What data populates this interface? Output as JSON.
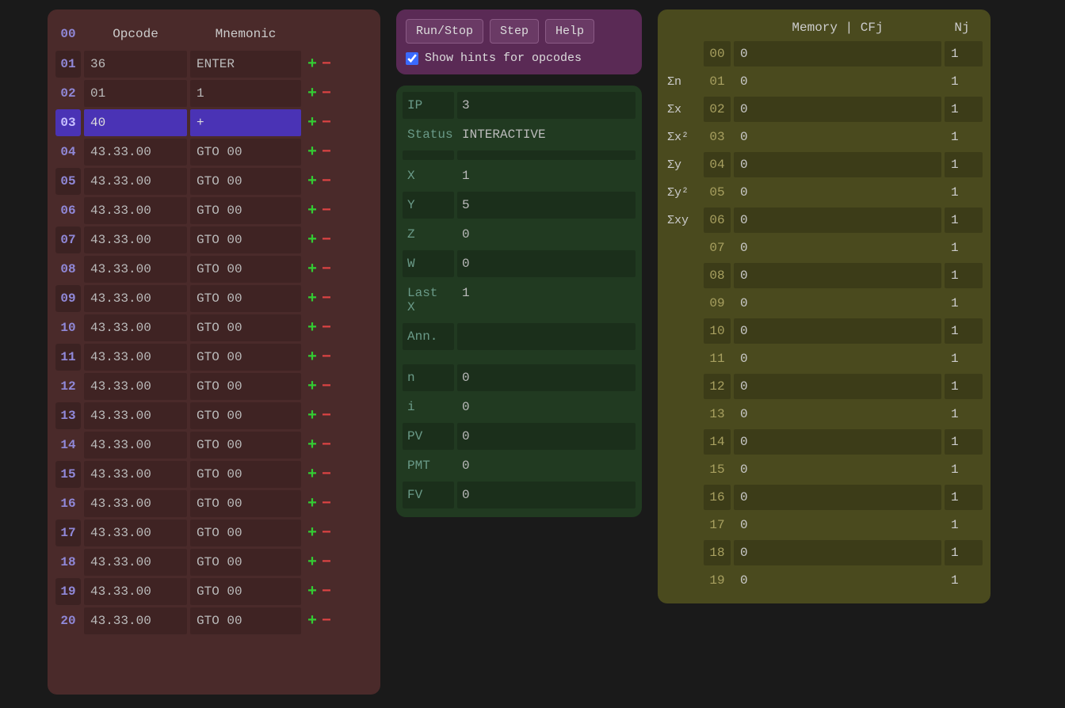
{
  "program": {
    "headers": {
      "opcode": "Opcode",
      "mnemonic": "Mnemonic",
      "zero": "00"
    },
    "selected_line": "03",
    "rows": [
      {
        "n": "01",
        "op": "36",
        "mn": "ENTER"
      },
      {
        "n": "02",
        "op": "01",
        "mn": "1"
      },
      {
        "n": "03",
        "op": "40",
        "mn": "+"
      },
      {
        "n": "04",
        "op": "43.33.00",
        "mn": "GTO 00"
      },
      {
        "n": "05",
        "op": "43.33.00",
        "mn": "GTO 00"
      },
      {
        "n": "06",
        "op": "43.33.00",
        "mn": "GTO 00"
      },
      {
        "n": "07",
        "op": "43.33.00",
        "mn": "GTO 00"
      },
      {
        "n": "08",
        "op": "43.33.00",
        "mn": "GTO 00"
      },
      {
        "n": "09",
        "op": "43.33.00",
        "mn": "GTO 00"
      },
      {
        "n": "10",
        "op": "43.33.00",
        "mn": "GTO 00"
      },
      {
        "n": "11",
        "op": "43.33.00",
        "mn": "GTO 00"
      },
      {
        "n": "12",
        "op": "43.33.00",
        "mn": "GTO 00"
      },
      {
        "n": "13",
        "op": "43.33.00",
        "mn": "GTO 00"
      },
      {
        "n": "14",
        "op": "43.33.00",
        "mn": "GTO 00"
      },
      {
        "n": "15",
        "op": "43.33.00",
        "mn": "GTO 00"
      },
      {
        "n": "16",
        "op": "43.33.00",
        "mn": "GTO 00"
      },
      {
        "n": "17",
        "op": "43.33.00",
        "mn": "GTO 00"
      },
      {
        "n": "18",
        "op": "43.33.00",
        "mn": "GTO 00"
      },
      {
        "n": "19",
        "op": "43.33.00",
        "mn": "GTO 00"
      },
      {
        "n": "20",
        "op": "43.33.00",
        "mn": "GTO 00"
      }
    ]
  },
  "controls": {
    "run_stop": "Run/Stop",
    "step": "Step",
    "help": "Help",
    "hints_label": "Show hints for opcodes",
    "hints_checked": true
  },
  "state": {
    "rows": [
      {
        "label": "IP",
        "value": "3"
      },
      {
        "label": "Status",
        "value": "INTERACTIVE"
      },
      {
        "label": "",
        "value": "",
        "spacer": true
      },
      {
        "label": "X",
        "value": "1"
      },
      {
        "label": "Y",
        "value": "5"
      },
      {
        "label": "Z",
        "value": "0"
      },
      {
        "label": "W",
        "value": "0"
      },
      {
        "label": "Last X",
        "value": "1"
      },
      {
        "label": "Ann.",
        "value": ""
      },
      {
        "label": "",
        "value": "",
        "spacer": true
      },
      {
        "label": "n",
        "value": "0"
      },
      {
        "label": "i",
        "value": "0"
      },
      {
        "label": "PV",
        "value": "0"
      },
      {
        "label": "PMT",
        "value": "0"
      },
      {
        "label": "FV",
        "value": "0"
      }
    ]
  },
  "memory": {
    "header": {
      "title": "Memory | CFj",
      "nj": "Nj"
    },
    "stat_labels": [
      "",
      "Σn",
      "Σx",
      "Σx²",
      "Σy",
      "Σy²",
      "Σxy",
      "",
      "",
      "",
      "",
      "",
      "",
      "",
      "",
      "",
      "",
      "",
      "",
      ""
    ],
    "rows": [
      {
        "idx": "00",
        "cfj": "0",
        "nj": "1"
      },
      {
        "idx": "01",
        "cfj": "0",
        "nj": "1"
      },
      {
        "idx": "02",
        "cfj": "0",
        "nj": "1"
      },
      {
        "idx": "03",
        "cfj": "0",
        "nj": "1"
      },
      {
        "idx": "04",
        "cfj": "0",
        "nj": "1"
      },
      {
        "idx": "05",
        "cfj": "0",
        "nj": "1"
      },
      {
        "idx": "06",
        "cfj": "0",
        "nj": "1"
      },
      {
        "idx": "07",
        "cfj": "0",
        "nj": "1"
      },
      {
        "idx": "08",
        "cfj": "0",
        "nj": "1"
      },
      {
        "idx": "09",
        "cfj": "0",
        "nj": "1"
      },
      {
        "idx": "10",
        "cfj": "0",
        "nj": "1"
      },
      {
        "idx": "11",
        "cfj": "0",
        "nj": "1"
      },
      {
        "idx": "12",
        "cfj": "0",
        "nj": "1"
      },
      {
        "idx": "13",
        "cfj": "0",
        "nj": "1"
      },
      {
        "idx": "14",
        "cfj": "0",
        "nj": "1"
      },
      {
        "idx": "15",
        "cfj": "0",
        "nj": "1"
      },
      {
        "idx": "16",
        "cfj": "0",
        "nj": "1"
      },
      {
        "idx": "17",
        "cfj": "0",
        "nj": "1"
      },
      {
        "idx": "18",
        "cfj": "0",
        "nj": "1"
      },
      {
        "idx": "19",
        "cfj": "0",
        "nj": "1"
      }
    ]
  }
}
